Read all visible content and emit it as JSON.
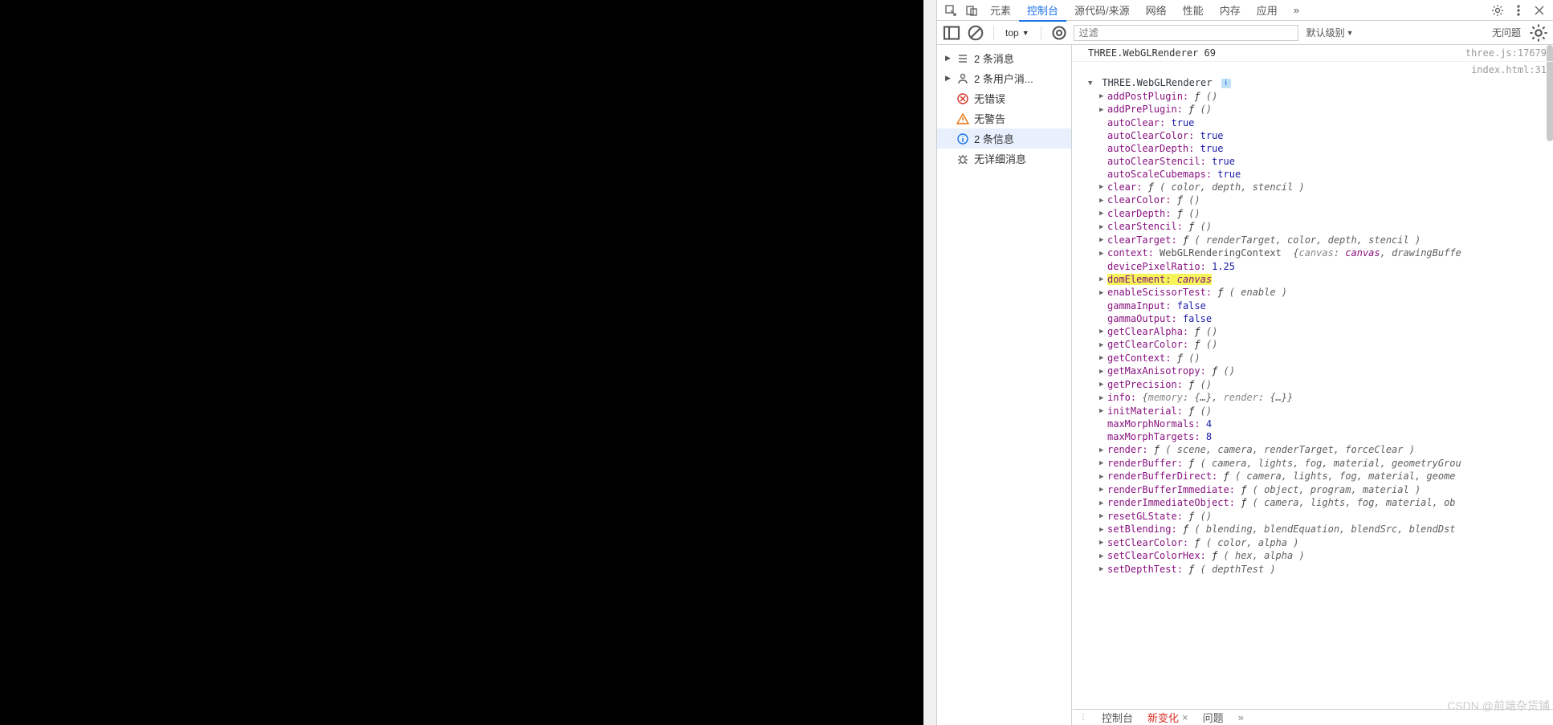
{
  "tabs": {
    "elements": "元素",
    "console": "控制台",
    "sources": "源代码/来源",
    "network": "网络",
    "performance": "性能",
    "memory": "内存",
    "application": "应用",
    "more": "»"
  },
  "toolbar": {
    "context": "top",
    "context_arrow": "▼",
    "filter_placeholder": "过滤",
    "level": "默认级别",
    "level_arrow": "▼",
    "issues": "无问题"
  },
  "sidebar": {
    "items": [
      {
        "icon": "list",
        "text": "2 条消息",
        "arrow": "▶"
      },
      {
        "icon": "user",
        "text": "2 条用户消...",
        "arrow": "▶"
      },
      {
        "icon": "error",
        "text": "无错误",
        "arrow": ""
      },
      {
        "icon": "warn",
        "text": "无警告",
        "arrow": ""
      },
      {
        "icon": "info",
        "text": "2 条信息",
        "arrow": "",
        "selected": true
      },
      {
        "icon": "debug",
        "text": "无详细消息",
        "arrow": ""
      }
    ]
  },
  "log1": {
    "text": "THREE.WebGLRenderer 69",
    "src": "three.js:17679"
  },
  "log2": {
    "header": "THREE.WebGLRenderer",
    "src": "index.html:31",
    "info": "i"
  },
  "props": [
    {
      "a": "right",
      "k": "addPostPlugin",
      "t": "fn",
      "args": "()"
    },
    {
      "a": "right",
      "k": "addPrePlugin",
      "t": "fn",
      "args": "()"
    },
    {
      "a": "none",
      "k": "autoClear",
      "t": "bool",
      "v": "true"
    },
    {
      "a": "none",
      "k": "autoClearColor",
      "t": "bool",
      "v": "true"
    },
    {
      "a": "none",
      "k": "autoClearDepth",
      "t": "bool",
      "v": "true"
    },
    {
      "a": "none",
      "k": "autoClearStencil",
      "t": "bool",
      "v": "true"
    },
    {
      "a": "none",
      "k": "autoScaleCubemaps",
      "t": "bool",
      "v": "true"
    },
    {
      "a": "right",
      "k": "clear",
      "t": "fn",
      "args": "( color, depth, stencil )"
    },
    {
      "a": "right",
      "k": "clearColor",
      "t": "fn",
      "args": "()"
    },
    {
      "a": "right",
      "k": "clearDepth",
      "t": "fn",
      "args": "()"
    },
    {
      "a": "right",
      "k": "clearStencil",
      "t": "fn",
      "args": "()"
    },
    {
      "a": "right",
      "k": "clearTarget",
      "t": "fn",
      "args": "( renderTarget, color, depth, stencil )"
    },
    {
      "a": "right",
      "k": "context",
      "t": "ctx"
    },
    {
      "a": "none",
      "k": "devicePixelRatio",
      "t": "num",
      "v": "1.25"
    },
    {
      "a": "right",
      "k": "domElement",
      "t": "canvas",
      "hl": true
    },
    {
      "a": "right",
      "k": "enableScissorTest",
      "t": "fn",
      "args": "( enable )"
    },
    {
      "a": "none",
      "k": "gammaInput",
      "t": "bool",
      "v": "false"
    },
    {
      "a": "none",
      "k": "gammaOutput",
      "t": "bool",
      "v": "false"
    },
    {
      "a": "right",
      "k": "getClearAlpha",
      "t": "fn",
      "args": "()"
    },
    {
      "a": "right",
      "k": "getClearColor",
      "t": "fn",
      "args": "()"
    },
    {
      "a": "right",
      "k": "getContext",
      "t": "fn",
      "args": "()"
    },
    {
      "a": "right",
      "k": "getMaxAnisotropy",
      "t": "fn",
      "args": "()"
    },
    {
      "a": "right",
      "k": "getPrecision",
      "t": "fn",
      "args": "()"
    },
    {
      "a": "right",
      "k": "info",
      "t": "info"
    },
    {
      "a": "right",
      "k": "initMaterial",
      "t": "fn",
      "args": "()"
    },
    {
      "a": "none",
      "k": "maxMorphNormals",
      "t": "num",
      "v": "4"
    },
    {
      "a": "none",
      "k": "maxMorphTargets",
      "t": "num",
      "v": "8"
    },
    {
      "a": "right",
      "k": "render",
      "t": "fn",
      "args": "( scene, camera, renderTarget, forceClear )"
    },
    {
      "a": "right",
      "k": "renderBuffer",
      "t": "fn",
      "args": "( camera, lights, fog, material, geometryGrou"
    },
    {
      "a": "right",
      "k": "renderBufferDirect",
      "t": "fn",
      "args": "( camera, lights, fog, material, geome"
    },
    {
      "a": "right",
      "k": "renderBufferImmediate",
      "t": "fn",
      "args": "( object, program, material )"
    },
    {
      "a": "right",
      "k": "renderImmediateObject",
      "t": "fn",
      "args": "( camera, lights, fog, material, ob"
    },
    {
      "a": "right",
      "k": "resetGLState",
      "t": "fn",
      "args": "()"
    },
    {
      "a": "right",
      "k": "setBlending",
      "t": "fn",
      "args": "( blending, blendEquation, blendSrc, blendDst"
    },
    {
      "a": "right",
      "k": "setClearColor",
      "t": "fn",
      "args": "( color, alpha )"
    },
    {
      "a": "right",
      "k": "setClearColorHex",
      "t": "fn",
      "args": "( hex, alpha )"
    },
    {
      "a": "right",
      "k": "setDepthTest",
      "t": "fn",
      "args": "( depthTest )"
    }
  ],
  "ctx": {
    "type": "WebGLRenderingContext",
    "lead": "{",
    "k1": "canvas",
    "v1": "canvas",
    "tail": ", drawingBuffe"
  },
  "info": {
    "lead": "{",
    "k1": "memory",
    "v1": "{…}",
    "sep": ", ",
    "k2": "render",
    "v2": "{…}",
    "end": "}"
  },
  "canvas_val": "canvas",
  "drawer": {
    "console": "控制台",
    "changes": "新变化",
    "sep": "×",
    "issues": "问题",
    "more": "»"
  },
  "watermark": "CSDN @前端杂货铺"
}
